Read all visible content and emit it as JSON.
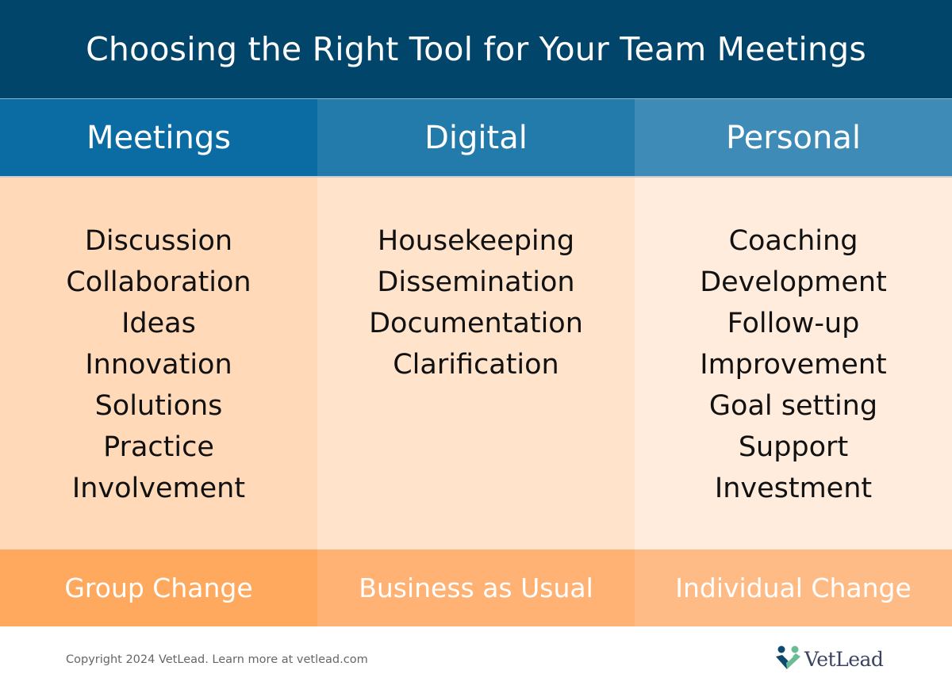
{
  "title": "Choosing the Right Tool for Your Team Meetings",
  "columns": [
    {
      "header": "Meetings",
      "items": [
        "Discussion",
        "Collaboration",
        "Ideas",
        "Innovation",
        "Solutions",
        "Practice",
        "Involvement"
      ],
      "footer": "Group Change"
    },
    {
      "header": "Digital",
      "items": [
        "Housekeeping",
        "Dissemination",
        "Documentation",
        "Clarification"
      ],
      "footer": "Business as Usual"
    },
    {
      "header": "Personal",
      "items": [
        "Coaching",
        "Development",
        "Follow-up",
        "Improvement",
        "Goal setting",
        "Support",
        "Investment"
      ],
      "footer": "Individual Change"
    }
  ],
  "footer": {
    "copyright": "Copyright 2024 VetLead. Learn more at vetlead.com",
    "logo_text": "VetLead",
    "logo_icon": "two-people-heart-icon"
  },
  "colors": {
    "title_bg": "#02456b",
    "header_bgs": [
      "#0b6ca3",
      "#237bac",
      "#3d8bb6"
    ],
    "body_bgs": [
      "#ffd9b8",
      "#ffe3cb",
      "#ffecdc"
    ],
    "footer_bgs": [
      "#ffa95e",
      "#ffb273",
      "#ffbb85"
    ]
  }
}
